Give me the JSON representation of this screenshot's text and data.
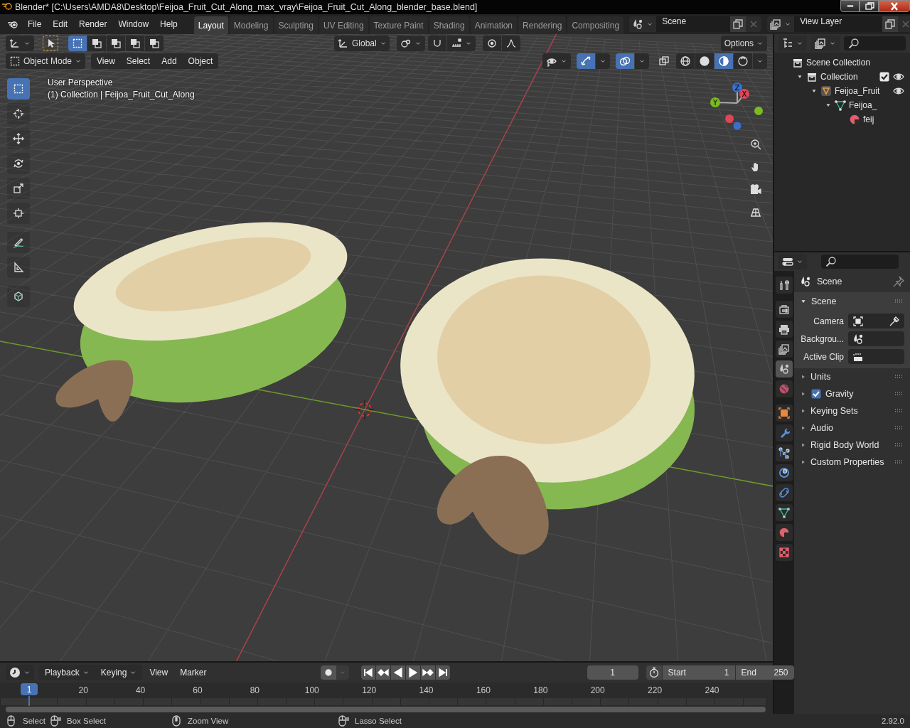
{
  "window": {
    "title": "Blender* [C:\\Users\\AMDA8\\Desktop\\Feijoa_Fruit_Cut_Along_max_vray\\Feijoa_Fruit_Cut_Along_blender_base.blend]"
  },
  "menu_bar": [
    "File",
    "Edit",
    "Render",
    "Window",
    "Help"
  ],
  "workspaces": [
    {
      "label": "Layout",
      "selected": true
    },
    {
      "label": "Modeling",
      "selected": false
    },
    {
      "label": "Sculpting",
      "selected": false
    },
    {
      "label": "UV Editing",
      "selected": false
    },
    {
      "label": "Texture Paint",
      "selected": false
    },
    {
      "label": "Shading",
      "selected": false
    },
    {
      "label": "Animation",
      "selected": false
    },
    {
      "label": "Rendering",
      "selected": false
    },
    {
      "label": "Compositing",
      "selected": false
    }
  ],
  "scene": {
    "value": "Scene"
  },
  "view_layer": {
    "value": "View Layer"
  },
  "viewport": {
    "orientation": "Global",
    "options": "Options",
    "mode": "Object Mode",
    "menus": [
      "View",
      "Select",
      "Add",
      "Object"
    ],
    "select_modes": [
      {
        "selected": true
      },
      {
        "selected": false
      },
      {
        "selected": false
      },
      {
        "selected": false
      },
      {
        "selected": false
      }
    ],
    "gizmos": {
      "on": true
    },
    "overlays": {
      "on": true
    },
    "xray": {
      "on": false
    },
    "shading": [
      {
        "kind": "wireframe",
        "selected": false
      },
      {
        "kind": "solid",
        "selected": false
      },
      {
        "kind": "material",
        "selected": true
      },
      {
        "kind": "rendered",
        "selected": false
      }
    ],
    "info": [
      "User Perspective",
      "(1) Collection | Feijoa_Fruit_Cut_Along"
    ],
    "tools": [
      {
        "kind": "select",
        "selected": true
      },
      {
        "kind": "cursor",
        "selected": false
      },
      {
        "kind": "move",
        "selected": false
      },
      {
        "kind": "rotate",
        "selected": false
      },
      {
        "kind": "scale",
        "selected": false
      },
      {
        "kind": "transform",
        "selected": false
      },
      {
        "kind": "annotate",
        "selected": false
      },
      {
        "kind": "measure",
        "selected": false
      },
      {
        "kind": "add_cube",
        "selected": false
      }
    ],
    "gizmo_axes": [
      "Z",
      "X",
      "Y"
    ]
  },
  "outliner": {
    "tree": [
      {
        "kind": "scene_collection",
        "label": "Scene Collection",
        "children": [
          {
            "kind": "collection",
            "label": "Collection",
            "expanded": true,
            "checked": true,
            "visible": true,
            "children": [
              {
                "kind": "object",
                "label": "Feijoa_Fruit",
                "expanded": true,
                "visible": true,
                "children": [
                  {
                    "kind": "mesh",
                    "label": "Feijoa_",
                    "expanded": true,
                    "children": [
                      {
                        "kind": "material",
                        "label": "feij"
                      }
                    ]
                  }
                ]
              }
            ]
          }
        ]
      }
    ]
  },
  "properties": {
    "tabs": [
      {
        "kind": "tool",
        "selected": false
      },
      {
        "kind": "render",
        "selected": false
      },
      {
        "kind": "output",
        "selected": false
      },
      {
        "kind": "view_layer",
        "selected": false
      },
      {
        "kind": "scene",
        "selected": true
      },
      {
        "kind": "world",
        "selected": false
      },
      {
        "kind": "object",
        "selected": false
      },
      {
        "kind": "modifier",
        "selected": false
      },
      {
        "kind": "particles",
        "selected": false
      },
      {
        "kind": "physics",
        "selected": false
      },
      {
        "kind": "constraints",
        "selected": false
      },
      {
        "kind": "data",
        "selected": false
      },
      {
        "kind": "material",
        "selected": false
      },
      {
        "kind": "texture",
        "selected": false
      }
    ],
    "context": "Scene",
    "panel": {
      "title": "Scene",
      "expanded": true,
      "fields": [
        {
          "label": "Camera",
          "kind": "camera"
        },
        {
          "label": "Backgrou...",
          "kind": "scene"
        },
        {
          "label": "Active Clip",
          "kind": "clip"
        }
      ]
    },
    "subpanels": [
      {
        "title": "Units",
        "expanded": false
      },
      {
        "title": "Gravity",
        "expanded": false,
        "checked": true
      },
      {
        "title": "Keying Sets",
        "expanded": false
      },
      {
        "title": "Audio",
        "expanded": false
      },
      {
        "title": "Rigid Body World",
        "expanded": false
      },
      {
        "title": "Custom Properties",
        "expanded": false
      }
    ]
  },
  "timeline": {
    "dropdowns": [
      "Playback",
      "Keying"
    ],
    "menus": [
      "View",
      "Marker"
    ],
    "auto_key": {
      "on": false
    },
    "current_frame": "1",
    "start_label": "Start",
    "start": "1",
    "end_label": "End",
    "end": "250",
    "marker": "1",
    "ruler": [
      "20",
      "40",
      "60",
      "80",
      "100",
      "120",
      "140",
      "160",
      "180",
      "200",
      "220",
      "240"
    ]
  },
  "status_bar": {
    "hints": [
      {
        "kind": "left",
        "label": "Select"
      },
      {
        "kind": "drag",
        "label": "Box Select"
      },
      {
        "kind": "middle",
        "label": "Zoom View"
      },
      {
        "kind": "right_drag",
        "label": "Lasso Select"
      }
    ],
    "version": "2.92.0"
  }
}
